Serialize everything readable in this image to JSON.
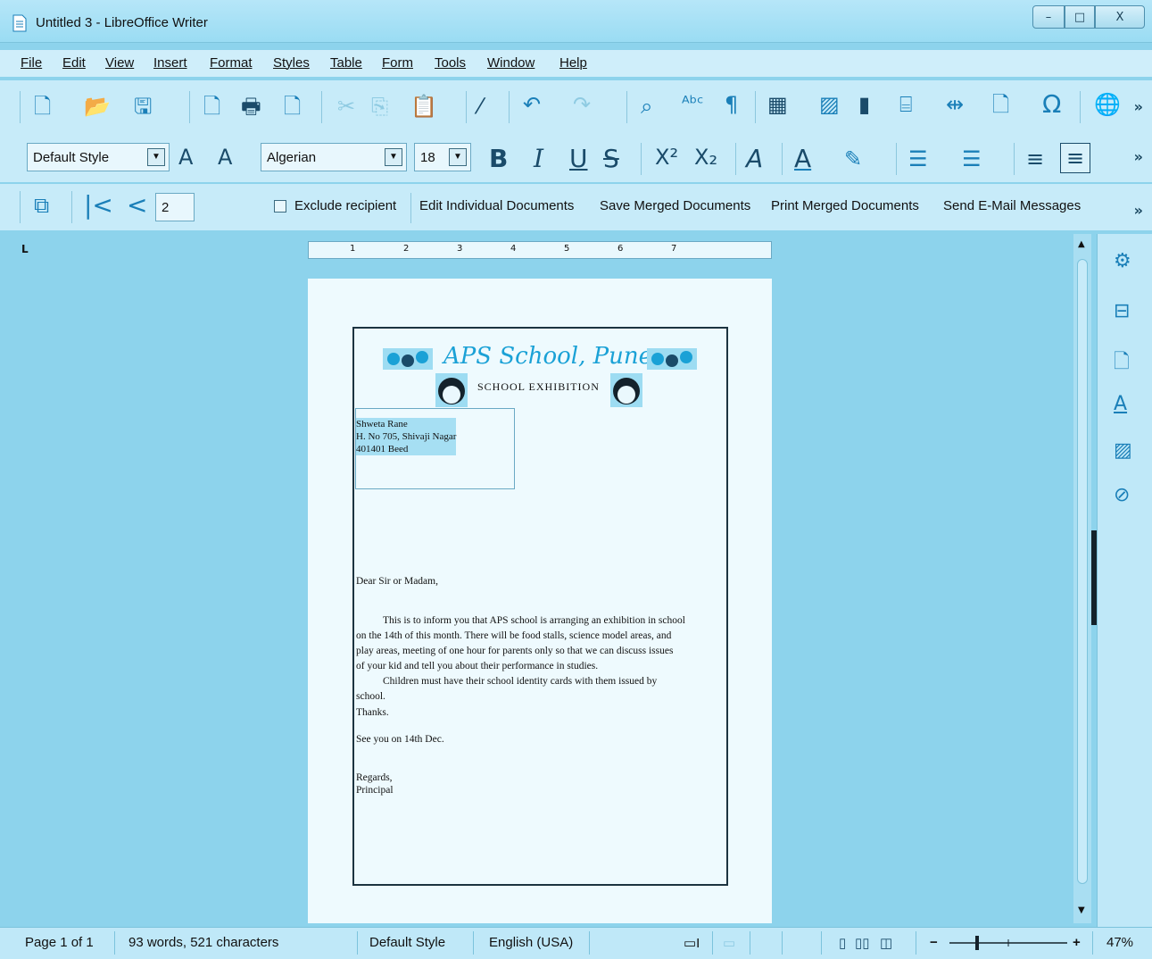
{
  "window": {
    "title": "Untitled 3 - LibreOffice Writer",
    "controls": {
      "minimize": "–",
      "maximize": "□",
      "close": "X"
    }
  },
  "menu": [
    "File",
    "Edit",
    "View",
    "Insert",
    "Format",
    "Styles",
    "Table",
    "Form",
    "Tools",
    "Window",
    "Help"
  ],
  "formatting": {
    "paragraph_style": "Default Style",
    "font_name": "Algerian",
    "font_size": "18",
    "bold": "B",
    "italic": "I",
    "underline": "U",
    "strike": "S",
    "superscript": "X²",
    "subscript": "X₂",
    "more": "»"
  },
  "mailmerge": {
    "record": "2",
    "exclude_label": "Exclude recipient",
    "edit_docs": "Edit Individual Documents",
    "save_docs": "Save Merged Documents",
    "print_docs": "Print Merged Documents",
    "send_email": "Send E-Mail Messages"
  },
  "ruler_marks": [
    "1",
    "2",
    "3",
    "4",
    "5",
    "6",
    "7"
  ],
  "document": {
    "school_name": "APS School, Pune",
    "subtitle": "SCHOOL EXHIBITION",
    "address": [
      "Shweta Rane",
      "H. No 705, Shivaji Nagar",
      "401401 Beed"
    ],
    "salutation": "Dear Sir or Madam,",
    "body_lines": [
      "This is to inform you that APS school is arranging an exhibition in school",
      "on the 14th of this month. There will be food stalls, science model areas, and",
      "play areas, meeting of one hour for parents only so that we can discuss issues",
      "of your kid and tell you about their performance in studies.",
      "Children must have their school identity cards with them issued by",
      "school.",
      "Thanks."
    ],
    "see_you": "See you on 14th Dec.",
    "regards": "Regards,",
    "signoff": "Principal"
  },
  "status": {
    "page": "Page 1 of 1",
    "words": "93 words, 521 characters",
    "style": "Default Style",
    "language": "English (USA)",
    "zoom": "47%",
    "zoom_value": 0.47
  },
  "icons": {
    "sidebar": [
      "properties-icon",
      "styles-icon",
      "page-icon",
      "font-icon",
      "gallery-icon",
      "navigator-icon"
    ]
  }
}
